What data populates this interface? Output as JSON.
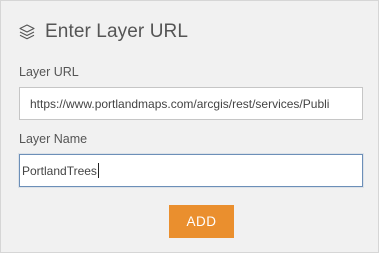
{
  "header": {
    "icon": "layers-icon",
    "title": "Enter Layer URL"
  },
  "form": {
    "url_label": "Layer URL",
    "url_value": "https://www.portlandmaps.com/arcgis/rest/services/Publi",
    "name_label": "Layer Name",
    "name_value": "PortlandTrees"
  },
  "actions": {
    "add_label": "ADD"
  },
  "colors": {
    "accent": "#ea8f2e",
    "panel_bg": "#f1f1f1",
    "focus_border": "#6c8fb8"
  }
}
